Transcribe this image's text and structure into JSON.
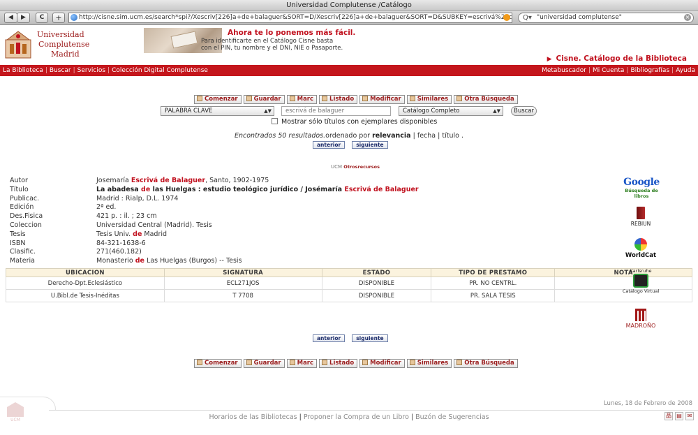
{
  "browser": {
    "window_title": "Universidad Complutense /Catálogo",
    "back_icon": "◀",
    "forward_icon": "▶",
    "reload_icon": "C",
    "add_icon": "+",
    "url": "http://cisne.sim.ucm.es/search*spi?/Xescriv[226]a+de+balaguer&SORT=D/Xescriv[226]a+de+balaguer&SORT=D&SUBKEY=escrivá%20de%20bala",
    "search_value": "\"universidad complutense\"",
    "search_mag_icon": "Q▾",
    "search_clear_icon": "×"
  },
  "header": {
    "uni_name": [
      "Universidad",
      "Complutense",
      "Madrid"
    ],
    "banner_line1": "Ahora te lo ponemos más fácil.",
    "banner_line2": "Para identificarte en el Catálogo Cisne basta",
    "banner_line3": "con el PIN, tu nombre y el DNI, NIE o Pasaporte.",
    "cisne_title": "Cisne. Catálogo de la Biblioteca",
    "cisne_arrow": "▶"
  },
  "nav": {
    "left": [
      "La Biblioteca",
      "Buscar",
      "Servicios",
      "Colección Digital Complutense"
    ],
    "right": [
      "Metabuscador",
      "Mi Cuenta",
      "Bibliografías",
      "Ayuda"
    ]
  },
  "actions": [
    "Comenzar",
    "Guardar",
    "Marc",
    "Listado",
    "Modificar",
    "Similares",
    "Otra Búsqueda"
  ],
  "search": {
    "type_value": "PALABRA CLAVE",
    "query_value": "escrivá de balaguer",
    "scope_value": "Catálogo Completo",
    "button_label": "Buscar",
    "checkbox_label": "Mostrar sólo títulos con ejemplares disponibles",
    "select_arrow": "▲▼"
  },
  "results": {
    "found_text": "Encontrados 50 resultados.",
    "ordered_by": "ordenado por",
    "relevance": "relevancia",
    "sort_fecha": "fecha",
    "sort_titulo": "título",
    "sep": "|",
    "end": "."
  },
  "pager": {
    "prev": "anterior",
    "next": "siguiente"
  },
  "otros": {
    "ucm": "UCM",
    "label1": "Otros",
    "label2": "recursos"
  },
  "record": {
    "autor_label": "Autor",
    "autor_pre": "Josemaría ",
    "autor_hl": "Escrivá de Balaguer",
    "autor_post": ", Santo, 1902-1975",
    "titulo_label": "Título",
    "titulo_a": "La abadesa ",
    "titulo_de": "de",
    "titulo_b": " las Huelgas : estudio teológico jurídico / Josémaría ",
    "titulo_hl": "Escrivá de Balaguer",
    "publicac_label": "Publicac.",
    "publicac": "Madrid : Rialp, D.L. 1974",
    "edicion_label": "Edición",
    "edicion": "2ª ed.",
    "desfisica_label": "Des.Fisica",
    "desfisica": "421 p. : il. ; 23 cm",
    "coleccion_label": "Coleccion",
    "coleccion": "Universidad Central (Madrid). Tesis",
    "tesis_label": "Tesis",
    "tesis_pre": "Tesis Univ. ",
    "tesis_de": "de",
    "tesis_post": " Madrid",
    "isbn_label": "ISBN",
    "isbn": "84-321-1638-6",
    "clasif_label": "Clasific.",
    "clasif": "271(460.182)",
    "materia_label": "Materia",
    "materia_pre": "Monasterio ",
    "materia_de": "de",
    "materia_post": " Las Huelgas (Burgos) -- Tesis"
  },
  "holdings": {
    "headers": [
      "UBICACION",
      "SIGNATURA",
      "ESTADO",
      "TIPO DE PRESTAMO",
      "NOTA"
    ],
    "rows": [
      [
        "Derecho-Dpt.Eclesiástico",
        "ECL271JOS",
        "DISPONIBLE",
        "PR. NO CENTRL.",
        ""
      ],
      [
        "U.Bibl.de Tesis-Inéditas",
        "T 7708",
        "DISPONIBLE",
        "PR. SALA TESIS",
        ""
      ]
    ]
  },
  "sidebar": {
    "google_g": "Google",
    "google_sub": "Búsqueda de libros",
    "rebiun": "REBIUN",
    "worldcat": "WorldCat",
    "karl_top": "Karlsruhe",
    "karl_bottom": "Catálogo Virtual",
    "madrono": "MADROÑO"
  },
  "footer": {
    "date": "Lunes, 18 de Febrero de 2008",
    "links": [
      "Horarios de las Bibliotecas",
      "Proponer la Compra de un Libro",
      "Buzón de Sugerencias"
    ],
    "ucm_mark": "UCM",
    "icon_sitemap": "品",
    "icon_doc": "▤",
    "icon_mail": "✉"
  },
  "colors": {
    "brand_red": "#c4161c",
    "highlight_red": "#c1121f"
  }
}
